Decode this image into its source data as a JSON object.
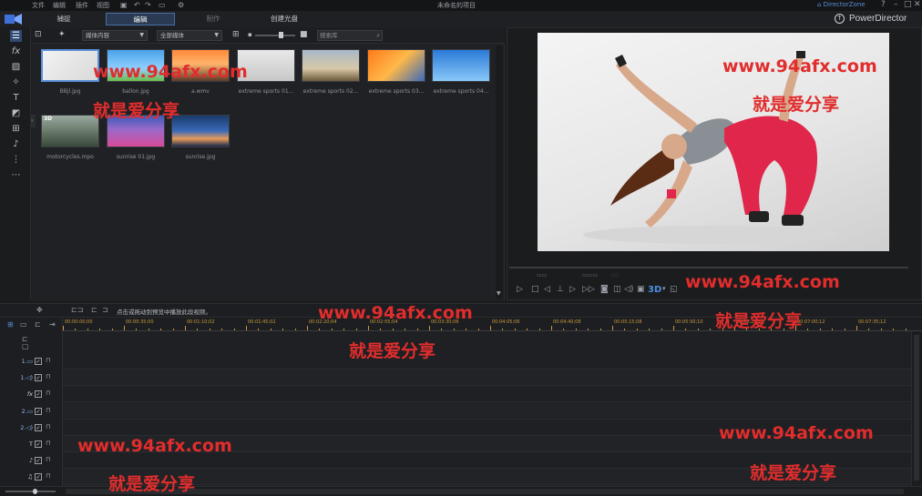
{
  "menu": {
    "items": [
      "文件",
      "编辑",
      "插件",
      "视图"
    ],
    "app_title": "未命名的项目"
  },
  "directorzone": "DirectorZone",
  "window_controls": {
    "help": "?",
    "minimize": "–",
    "restore": "□",
    "close": "✕"
  },
  "modes": {
    "tabs": [
      "捕捉",
      "编辑",
      "制作",
      "创建光盘"
    ],
    "active": "编辑"
  },
  "brand": "PowerDirector",
  "library": {
    "filter_select": "媒体内容",
    "sort_select": "全部媒体",
    "search_placeholder": "搜索库",
    "items": [
      {
        "label": "BBjl.jpg",
        "thumb": "dancer",
        "selected": true
      },
      {
        "label": "ballon.jpg",
        "thumb": "balloons"
      },
      {
        "label": "a.wmv",
        "thumb": "sunset-lake"
      },
      {
        "label": "extreme sports 01...",
        "thumb": "bmx"
      },
      {
        "label": "extreme sports 02...",
        "thumb": "motocross"
      },
      {
        "label": "extreme sports 03...",
        "thumb": "bike-orange"
      },
      {
        "label": "extreme sports 04...",
        "thumb": "skydiver"
      },
      {
        "label": "motorcycles.mpo",
        "thumb": "motorcycles",
        "badge": "3D"
      },
      {
        "label": "sunrise 01.jpg",
        "thumb": "flowers"
      },
      {
        "label": "sunrise.jpg",
        "thumb": "ocean-sunrise"
      }
    ]
  },
  "timeline": {
    "hint": "点击或拖动到预览中播放此段视频。",
    "ruler": [
      "00:00:00;00",
      "00:00:35;00",
      "00:01:10;02",
      "00:01:45;02",
      "00:02:20;04",
      "00:02:55;04",
      "00:03:30;06",
      "00:04:05;06",
      "00:04:40;08",
      "00:05:15;08",
      "00:05:50;10",
      "00:06:25;10",
      "00:07:00;12",
      "00:07:35;12"
    ],
    "tracks": [
      {
        "label": "1.",
        "type": "video"
      },
      {
        "label": "1.",
        "type": "audio"
      },
      {
        "label": "fx",
        "type": "effect"
      },
      {
        "label": "2.",
        "type": "video"
      },
      {
        "label": "2.",
        "type": "audio"
      },
      {
        "label": "T",
        "type": "title"
      },
      {
        "label": "",
        "type": "voice"
      },
      {
        "label": "",
        "type": "music"
      }
    ]
  },
  "preview": {
    "three_d_label": "3D"
  },
  "watermarks": {
    "url": "www.94afx.com",
    "cn": "就是爱分享"
  },
  "colors": {
    "accent": "#5a8fd8",
    "ruler": "#c79a3a",
    "watermark": "#e12d2d"
  }
}
